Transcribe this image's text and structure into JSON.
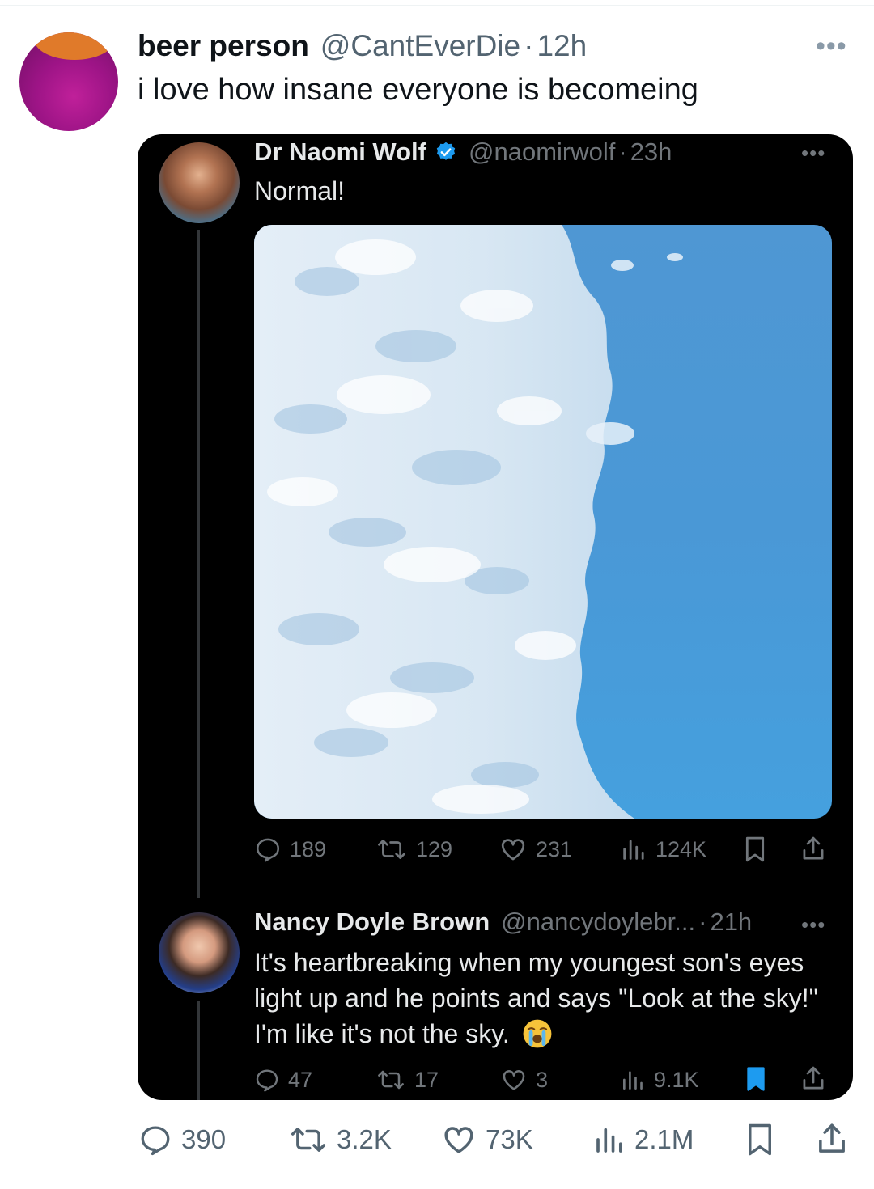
{
  "outer_tweet": {
    "name": "beer person",
    "handle": "@CantEverDie",
    "separator": "·",
    "time": "12h",
    "text": "i love how insane everyone is becomeing",
    "stats": {
      "replies": "390",
      "retweets": "3.2K",
      "likes": "73K",
      "views": "2.1M"
    }
  },
  "quoted_tweet": {
    "name": "Dr Naomi Wolf",
    "handle": "@naomirwolf",
    "separator": "·",
    "time": "23h",
    "text": "Normal!",
    "verified": true,
    "stats": {
      "replies": "189",
      "retweets": "129",
      "likes": "231",
      "views": "124K"
    }
  },
  "reply_tweet": {
    "name": "Nancy Doyle Brown",
    "handle": "@nancydoylebr...",
    "separator": "·",
    "time": "21h",
    "text": "It's heartbreaking when my youngest son's eyes light up and he points and says \"Look at the sky!\" I'm like it's not the sky.",
    "emoji": "loudly-crying-face",
    "bookmarked": true,
    "stats": {
      "replies": "47",
      "retweets": "17",
      "likes": "3",
      "views": "9.1K"
    }
  },
  "icons": [
    "more-icon",
    "verified-icon",
    "reply-icon",
    "retweet-icon",
    "like-icon",
    "views-icon",
    "bookmark-icon",
    "share-icon"
  ],
  "colors": {
    "card_bg": "#000000",
    "verified_blue": "#1d9bf0",
    "bookmark_active": "#1d9bf0"
  }
}
